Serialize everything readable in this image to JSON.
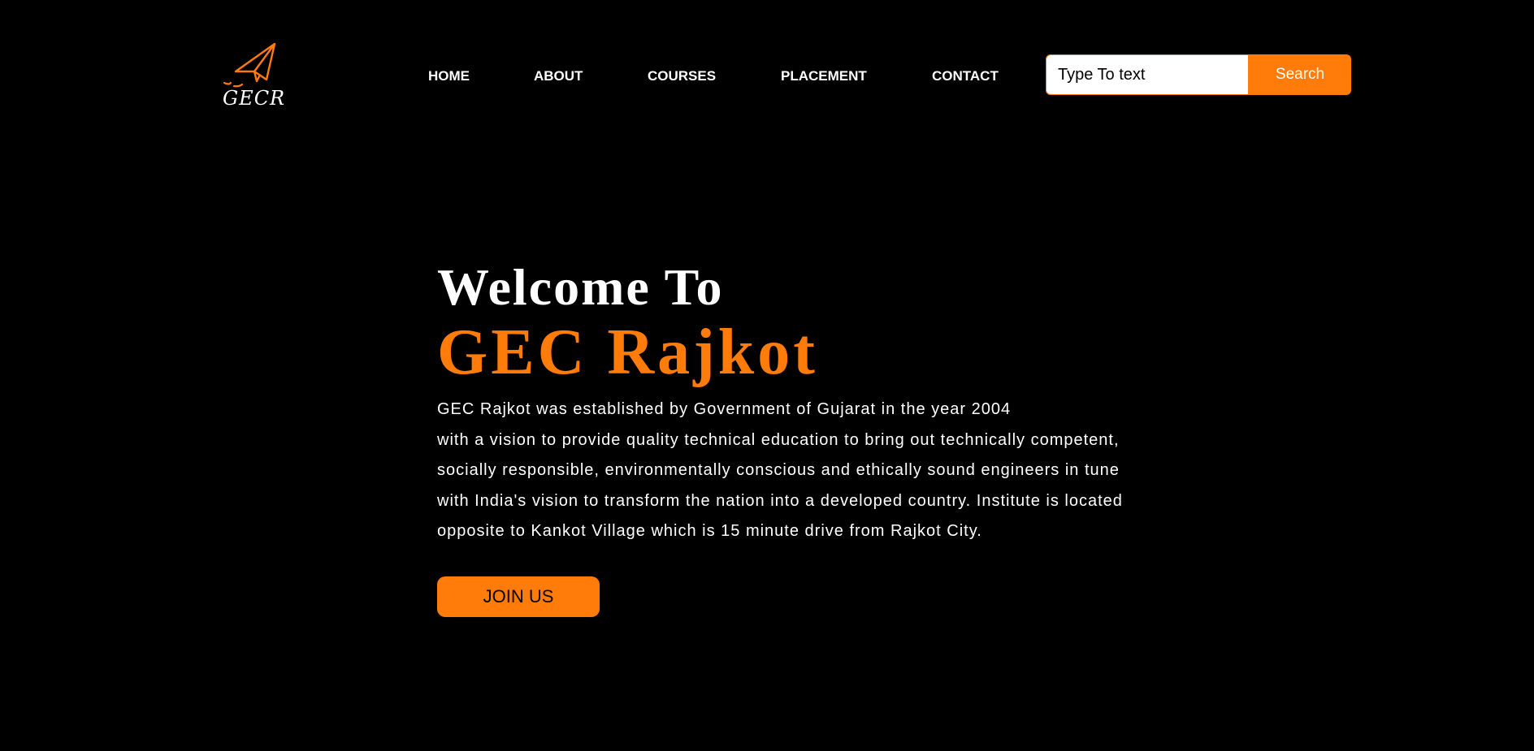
{
  "brand": {
    "logo_text": "GECR",
    "logo_icon": "paper-plane-icon",
    "accent_color": "#ff7b0a"
  },
  "nav": {
    "items": [
      {
        "label": "HOME"
      },
      {
        "label": "ABOUT"
      },
      {
        "label": "COURSES"
      },
      {
        "label": "PLACEMENT"
      },
      {
        "label": "CONTACT"
      }
    ]
  },
  "search": {
    "placeholder": "Type To text",
    "button_label": "Search"
  },
  "hero": {
    "welcome": "Welcome To",
    "college_name": "GEC Rajkot",
    "description_lines": [
      "GEC Rajkot was established by Government of Gujarat in the year 2004",
      "with a vision to provide quality technical education to bring out technically competent,",
      "socially responsible, environmentally conscious and ethically sound engineers in tune",
      "with India's vision to transform the nation into a developed country. Institute is located",
      "opposite to Kankot Village which is 15 minute drive from Rajkot City."
    ],
    "cta_label": "JOIN US"
  },
  "colors": {
    "background": "#000000",
    "accent": "#ff7b0a",
    "text": "#ffffff"
  }
}
